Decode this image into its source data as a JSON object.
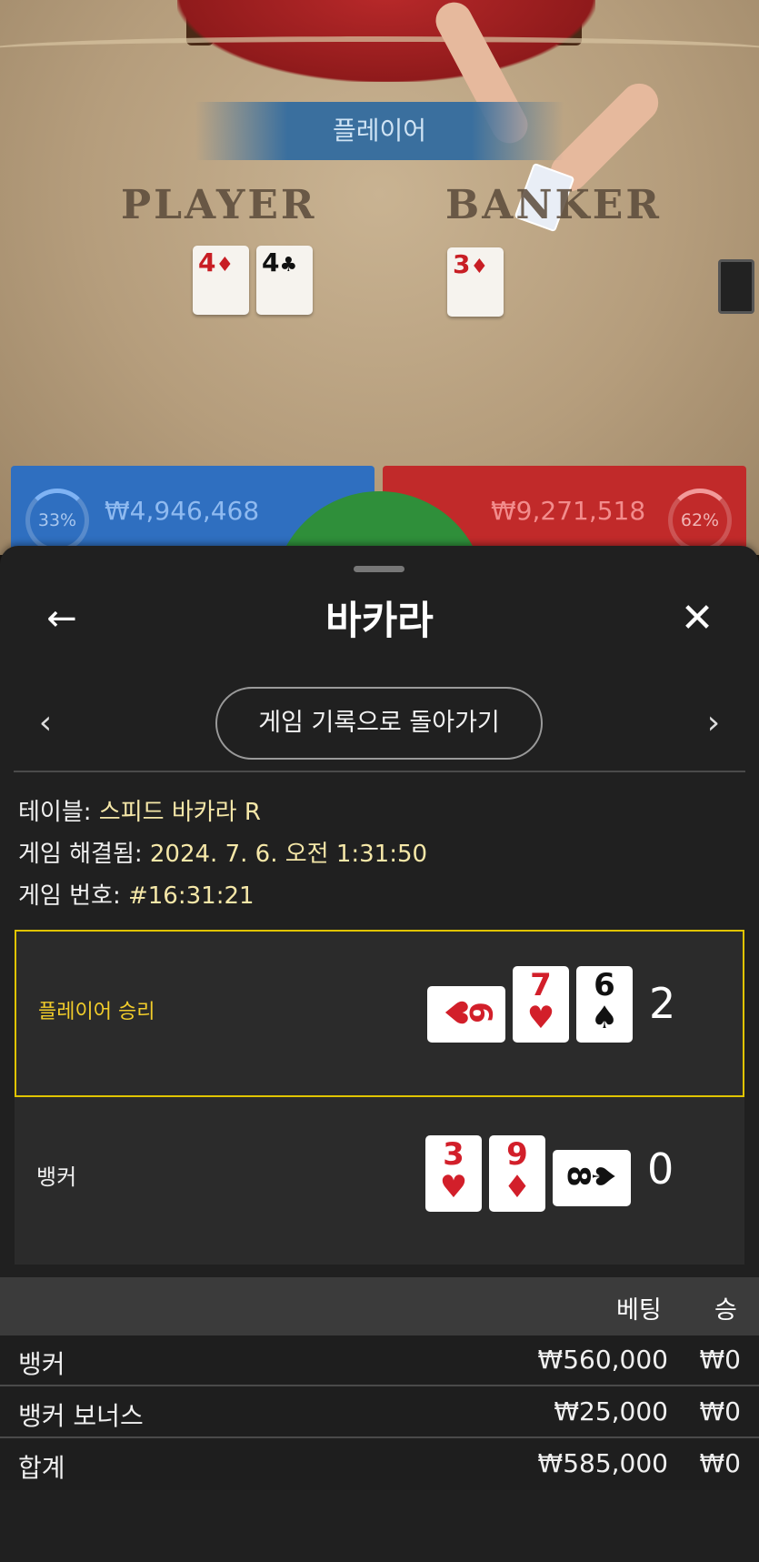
{
  "table": {
    "result_banner": "플레이어",
    "player_word": "PLAYER",
    "banker_word": "BANKER",
    "player_cards": [
      {
        "rank": "4",
        "suit": "♦",
        "color": "red"
      },
      {
        "rank": "4",
        "suit": "♣",
        "color": "black"
      }
    ],
    "banker_cards": [
      {
        "rank": "3",
        "suit": "♦",
        "color": "red"
      }
    ],
    "player_stats": {
      "percent": "33%",
      "amount": "₩4,946,468"
    },
    "banker_stats": {
      "percent": "62%",
      "amount": "₩9,271,518"
    }
  },
  "modal": {
    "back_icon": "←",
    "close_icon": "✕",
    "title": "바카라",
    "prev_icon": "‹",
    "next_icon": "›",
    "history_button": "게임 기록으로 돌아가기",
    "info": {
      "table_label": "테이블:",
      "table_value": "스피드 바카라 R",
      "resolved_label": "게임 해결됨:",
      "resolved_value": "2024. 7. 6. 오전 1:31:50",
      "game_no_label": "게임 번호:",
      "game_no_value": "#16:31:21"
    },
    "player_hand": {
      "label": "플레이어 승리",
      "score": "2",
      "cards": [
        {
          "rank": "6",
          "suit": "♥",
          "color": "red",
          "orientation": "side"
        },
        {
          "rank": "7",
          "suit": "♥",
          "color": "red",
          "orientation": "upright"
        },
        {
          "rank": "6",
          "suit": "♠",
          "color": "black",
          "orientation": "upright"
        }
      ]
    },
    "banker_hand": {
      "label": "뱅커",
      "score": "0",
      "cards": [
        {
          "rank": "3",
          "suit": "♥",
          "color": "red",
          "orientation": "upright"
        },
        {
          "rank": "9",
          "suit": "♦",
          "color": "red",
          "orientation": "upright"
        },
        {
          "rank": "8",
          "suit": "♠",
          "color": "black",
          "orientation": "side"
        }
      ]
    },
    "bets": {
      "header_bet": "베팅",
      "header_win": "승",
      "rows": [
        {
          "name": "뱅커",
          "bet": "₩560,000",
          "win": "₩0"
        },
        {
          "name": "뱅커 보너스",
          "bet": "₩25,000",
          "win": "₩0"
        },
        {
          "name": "합계",
          "bet": "₩585,000",
          "win": "₩0"
        }
      ]
    }
  }
}
